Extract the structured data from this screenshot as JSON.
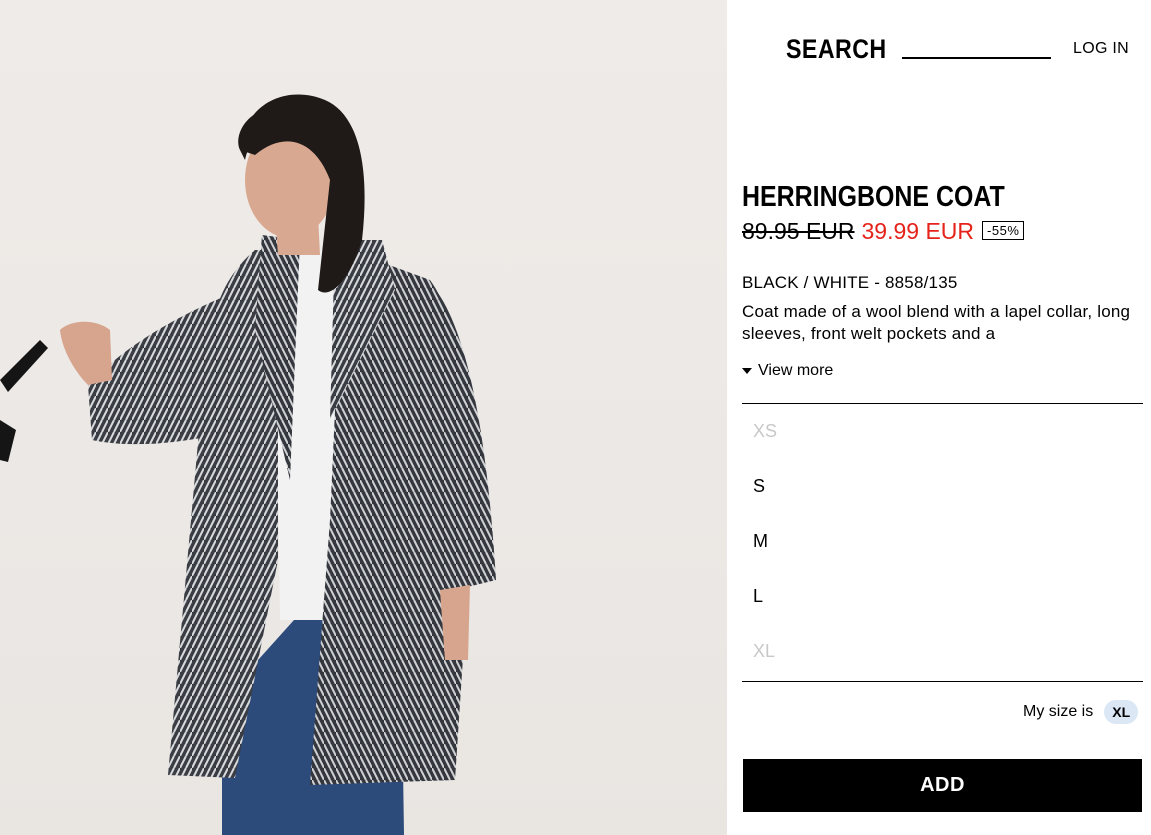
{
  "header": {
    "search_label": "SEARCH",
    "login_label": "LOG IN"
  },
  "product": {
    "title": "HERRINGBONE COAT",
    "old_price": "89.95 EUR",
    "new_price": "39.99 EUR",
    "discount": "-55%",
    "color_ref": "BLACK / WHITE - 8858/135",
    "description": "Coat made of a wool blend with a lapel collar, long sleeves, front welt pockets and a",
    "view_more_label": "View more"
  },
  "sizes": [
    {
      "label": "XS",
      "available": false
    },
    {
      "label": "S",
      "available": true
    },
    {
      "label": "M",
      "available": true
    },
    {
      "label": "L",
      "available": true
    },
    {
      "label": "XL",
      "available": false
    }
  ],
  "my_size": {
    "label": "My size is",
    "value": "XL"
  },
  "add_button_label": "ADD",
  "colors": {
    "sale_price": "#e5231b",
    "my_size_badge": "#dbe7f5",
    "unavailable_size": "#c8c8c8"
  }
}
